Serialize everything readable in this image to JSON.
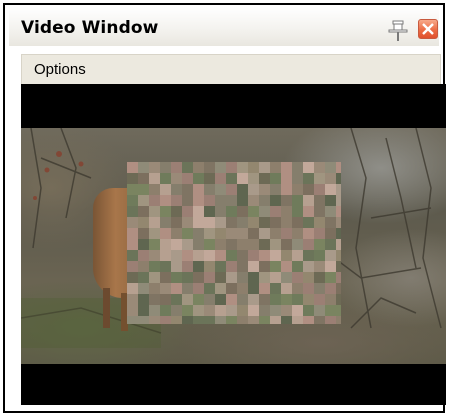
{
  "window": {
    "title": "Video Window",
    "pin_icon": "pin-icon",
    "close_icon": "close-icon",
    "close_color": "#ec6c44"
  },
  "menu": {
    "items": [
      {
        "label": "Options"
      }
    ]
  },
  "video": {
    "content": "video-frame",
    "background": "#000000"
  }
}
